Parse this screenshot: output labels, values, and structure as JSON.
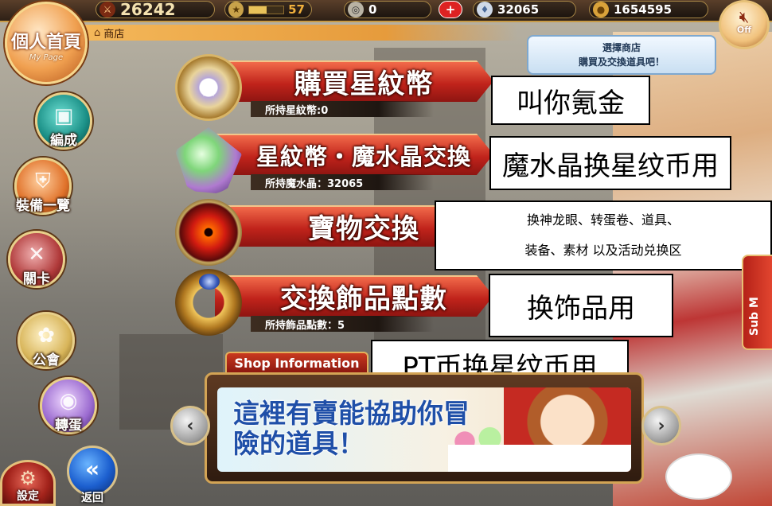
{
  "topbar": {
    "rank_value": "26242",
    "level_value": "57",
    "level_progress": 0.5,
    "crystal_count": "0",
    "magic_crystal_count": "32065",
    "gold_count": "1654595"
  },
  "mypage": {
    "title": "個人首頁",
    "subtitle": "My Page"
  },
  "breadcrumb": {
    "label": "商店"
  },
  "tip": {
    "line1": "選擇商店",
    "line2": "購買及交換道具吧！"
  },
  "sound": {
    "label": "Off"
  },
  "nav": {
    "team": "編成",
    "equipment": "裝備一覽",
    "stages": "關卡",
    "guild": "公會",
    "gacha": "轉蛋",
    "settings": "設定",
    "back": "返回"
  },
  "shops": [
    {
      "title": "購買星紋幣",
      "sub": "所持星紋幣:0"
    },
    {
      "title": "星紋幣・魔水晶交換",
      "sub": "所持魔水晶：32065"
    },
    {
      "title": "寶物交換",
      "sub": ""
    },
    {
      "title": "交換飾品點數",
      "sub": "所持飾品點數：5"
    }
  ],
  "annotations": {
    "a1": "叫你氪金",
    "a2": "魔水晶换星纹币用",
    "a3_line1": "换神龙眼、转蛋卷、道具、",
    "a3_line2": "装备、素材 以及活动兑换区",
    "a4": "换饰品用",
    "a5": "PT币换星纹币用"
  },
  "shop_info": {
    "tab_label": "Shop Information",
    "banner_text": "這裡有賣能協助你冒險的道具！"
  },
  "side_tab": {
    "label": "Sub M"
  },
  "colors": {
    "accent_red": "#c0231b",
    "gold": "#d3a455",
    "blue_text": "#1f4fa8"
  }
}
